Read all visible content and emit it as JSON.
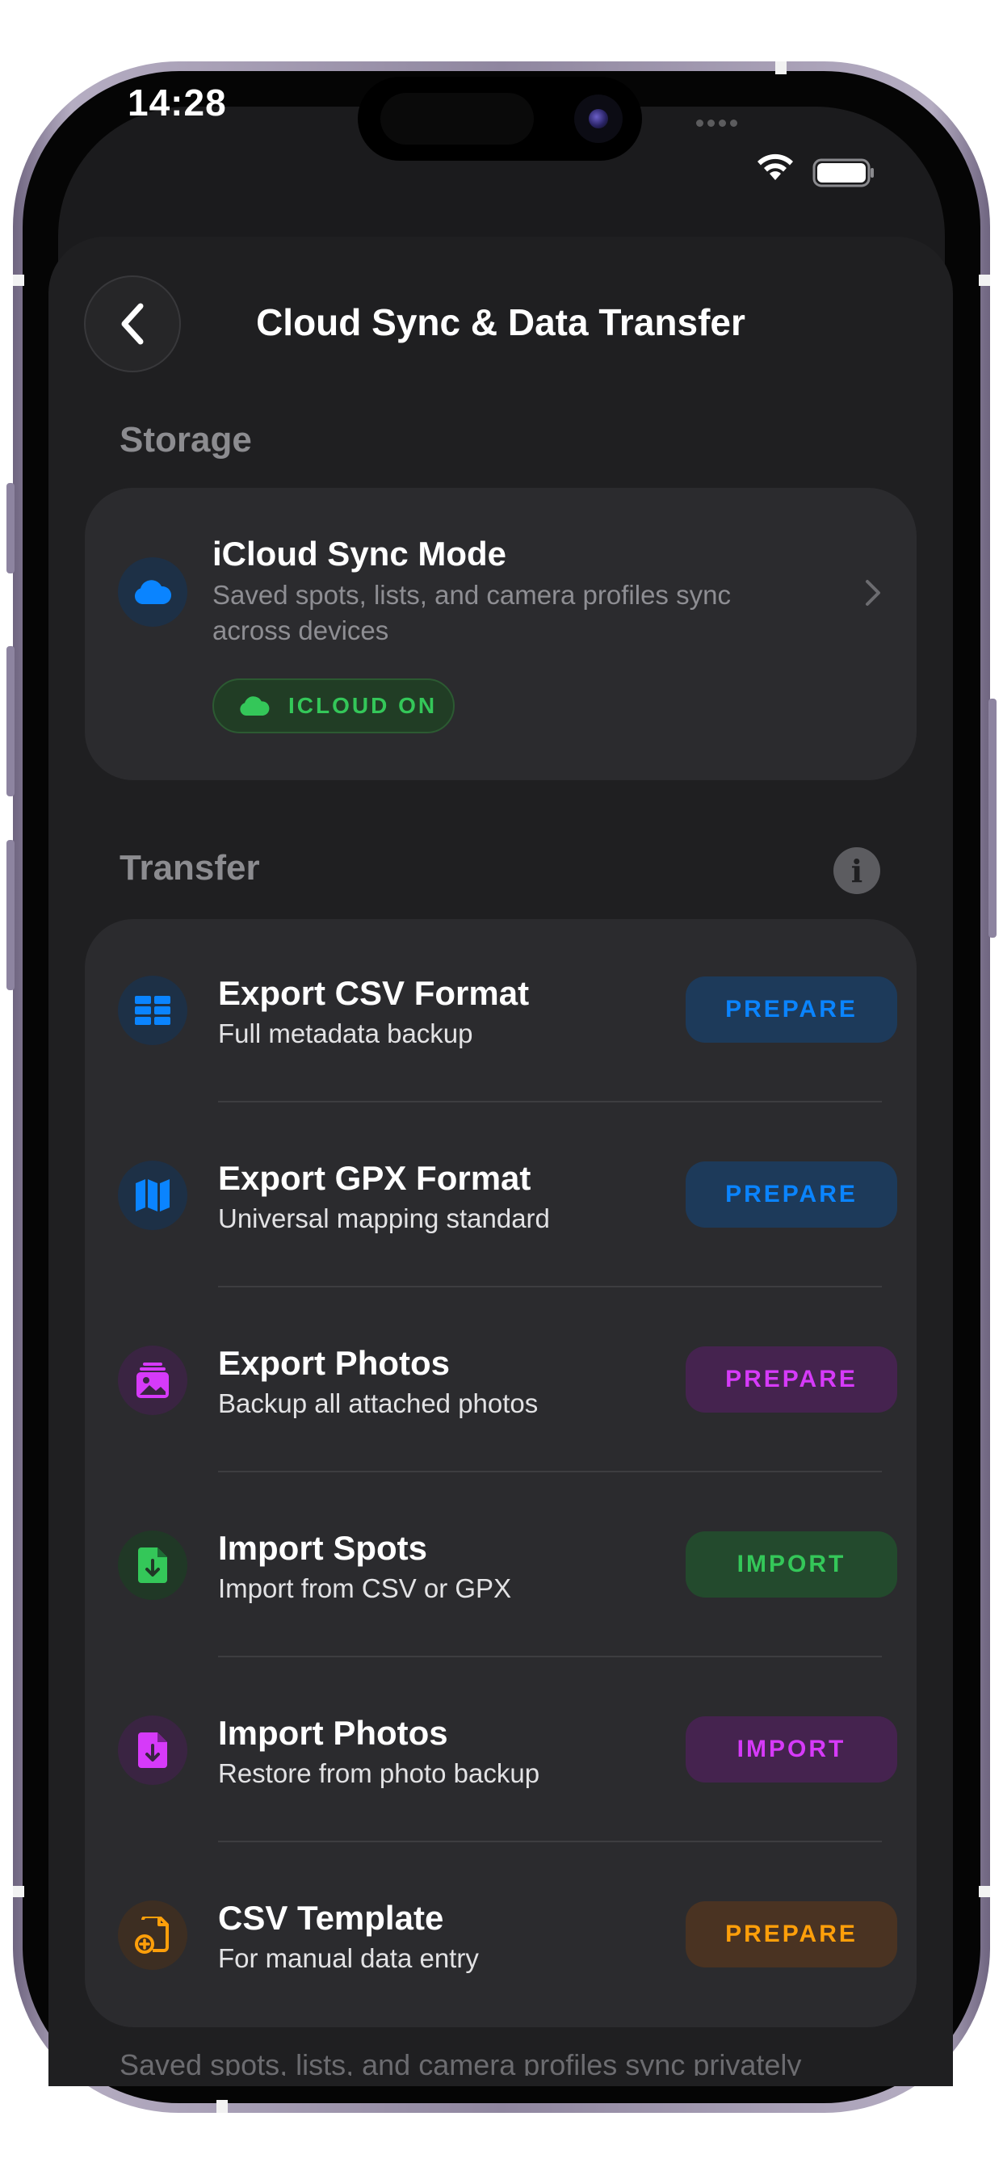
{
  "status_bar": {
    "time": "14:28"
  },
  "header": {
    "title": "Cloud Sync & Data Transfer"
  },
  "storage": {
    "section_title": "Storage",
    "sync_card": {
      "title": "iCloud Sync Mode",
      "subtitle_line1": "Saved spots, lists, and camera profiles sync",
      "subtitle_line2": "across devices",
      "badge_label": "ICLOUD ON",
      "icon": "cloud-icon"
    }
  },
  "transfer": {
    "section_title": "Transfer",
    "info_icon": "info-icon",
    "rows": [
      {
        "title": "Export CSV Format",
        "subtitle": "Full metadata backup",
        "button": "PREPARE",
        "icon": "table-icon",
        "color": "#0a84ff"
      },
      {
        "title": "Export GPX Format",
        "subtitle": "Universal mapping standard",
        "button": "PREPARE",
        "icon": "map-icon",
        "color": "#0a84ff"
      },
      {
        "title": "Export Photos",
        "subtitle": "Backup all attached photos",
        "button": "PREPARE",
        "icon": "photo-stack-icon",
        "color": "#d63af9"
      },
      {
        "title": "Import Spots",
        "subtitle": "Import from CSV or GPX",
        "button": "IMPORT",
        "icon": "document-download-icon",
        "color": "#34c759"
      },
      {
        "title": "Import Photos",
        "subtitle": "Restore from photo backup",
        "button": "IMPORT",
        "icon": "document-download-icon",
        "color": "#d63af9"
      },
      {
        "title": "CSV Template",
        "subtitle": "For manual data entry",
        "button": "PREPARE",
        "icon": "document-add-icon",
        "color": "#ff9f0a"
      }
    ]
  },
  "footer": {
    "text": "Saved spots, lists, and camera profiles sync privately"
  },
  "colors": {
    "accent_blue": "#0a84ff",
    "accent_green": "#34c759",
    "accent_purple": "#d63af9",
    "accent_orange": "#ff9f0a",
    "background": "#1f1f21",
    "card": "#2b2b2e"
  }
}
